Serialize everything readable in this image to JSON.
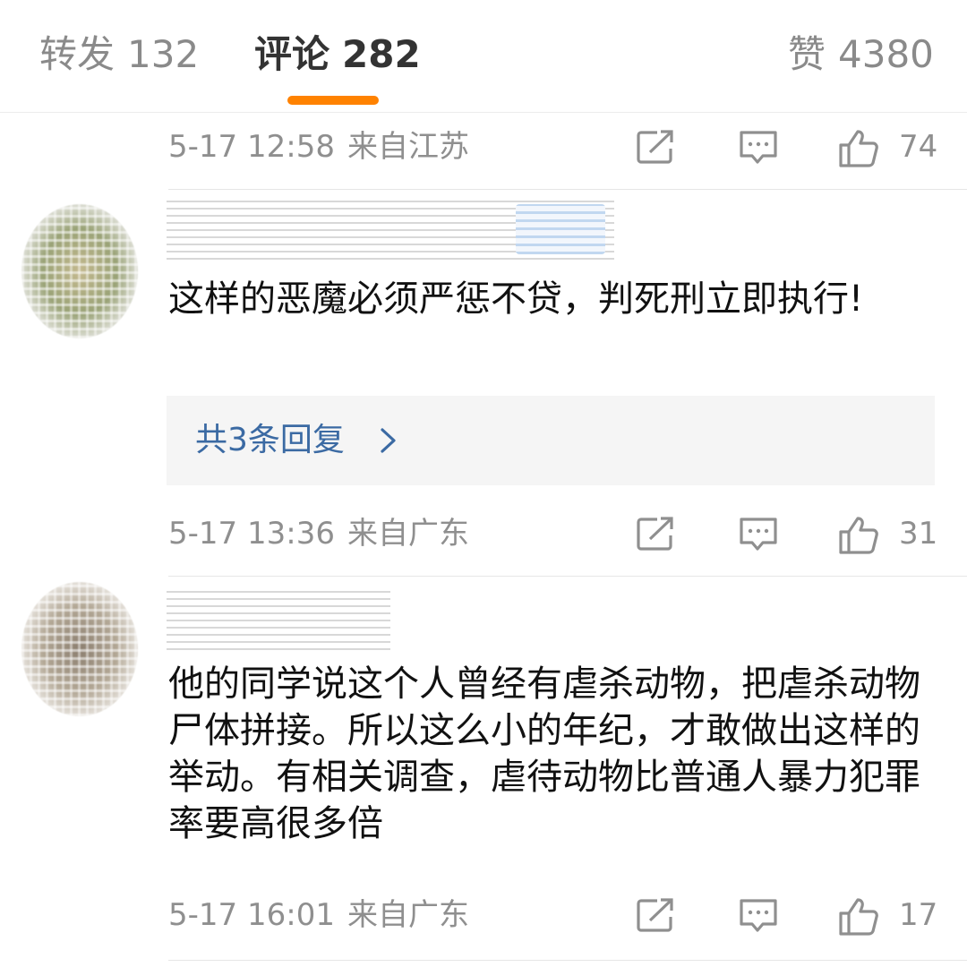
{
  "tabs": [
    {
      "label": "转发",
      "count": "132"
    },
    {
      "label": "评论",
      "count": "282"
    },
    {
      "label": "赞",
      "count": "4380"
    }
  ],
  "accent_color": "#ff8200",
  "top_meta": {
    "time": "5-17 12:58",
    "location": "来自江苏",
    "likes": "74"
  },
  "comments": [
    {
      "text": "这样的恶魔必须严惩不贷，判死刑立即执行!",
      "replies_label": "共3条回复",
      "time": "5-17 13:36",
      "location": "来自广东",
      "likes": "31"
    },
    {
      "text": "他的同学说这个人曾经有虐杀动物，把虐杀动物尸体拼接。所以这么小的年纪，才敢做出这样的举动。有相关调查，虐待动物比普通人暴力犯罪率要高很多倍",
      "time": "5-17 16:01",
      "location": "来自广东",
      "likes": "17"
    }
  ],
  "icons": {
    "share": "share-icon",
    "comment": "comment-icon",
    "like": "thumbs-up-icon",
    "chevron": "chevron-right-icon"
  }
}
